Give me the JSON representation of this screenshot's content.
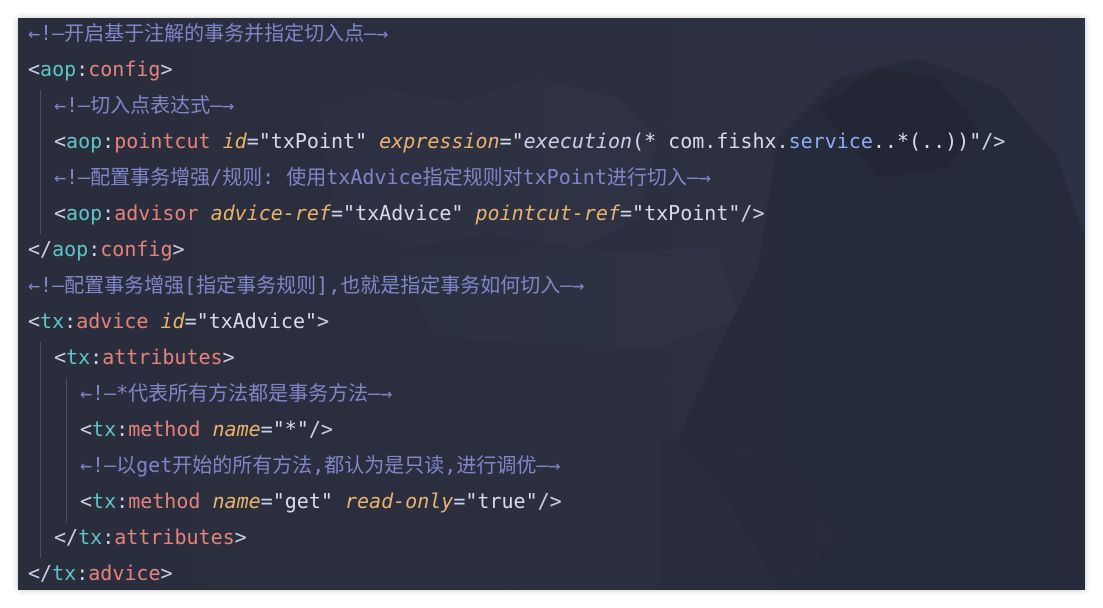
{
  "lines": [
    {
      "indent": 0,
      "comment": "←!—开启基于注解的事务并指定切入点—→"
    },
    {
      "indent": 0,
      "open": "<",
      "ns": "aop",
      "colon": ":",
      "tag": "config",
      "close": ">"
    },
    {
      "indent": 1,
      "comment": "←!—切入点表达式—→"
    },
    {
      "indent": 1,
      "open": "<",
      "ns": "aop",
      "colon": ":",
      "tag": "pointcut",
      "a1": "id",
      "v1": "\"txPoint\"",
      "a2": "expression",
      "v2pre": "=\"",
      "v2kw": "execution",
      "v2mid": "(* com.fishx.",
      "v2pkg": "service",
      "v2post": "..*(..))\"",
      "close": "/>"
    },
    {
      "indent": 1,
      "comment": "←!—配置事务增强/规则: 使用txAdvice指定规则对txPoint进行切入—→"
    },
    {
      "indent": 1,
      "open": "<",
      "ns": "aop",
      "colon": ":",
      "tag": "advisor",
      "a1": "advice-ref",
      "v1": "\"txAdvice\"",
      "a2": "pointcut-ref",
      "v2": "\"txPoint\"",
      "close": "/>"
    },
    {
      "indent": 0,
      "open": "</",
      "ns": "aop",
      "colon": ":",
      "tag": "config",
      "close": ">"
    },
    {
      "indent": 0,
      "comment": "←!—配置事务增强[指定事务规则],也就是指定事务如何切入—→"
    },
    {
      "indent": 0,
      "open": "<",
      "ns": "tx",
      "colon": ":",
      "tag": "advice",
      "a1": "id",
      "v1": "\"txAdvice\"",
      "close": ">"
    },
    {
      "indent": 1,
      "open": "<",
      "ns": "tx",
      "colon": ":",
      "tag": "attributes",
      "close": ">"
    },
    {
      "indent": 2,
      "comment": "←!—*代表所有方法都是事务方法—→"
    },
    {
      "indent": 2,
      "open": "<",
      "ns": "tx",
      "colon": ":",
      "tag": "method",
      "a1": "name",
      "v1": "\"*\"",
      "close": "/>"
    },
    {
      "indent": 2,
      "comment": "←!—以get开始的所有方法,都认为是只读,进行调优—→"
    },
    {
      "indent": 2,
      "open": "<",
      "ns": "tx",
      "colon": ":",
      "tag": "method",
      "a1": "name",
      "v1": "\"get\"",
      "a2": "read-only",
      "v2": "\"true\"",
      "close": "/>"
    },
    {
      "indent": 1,
      "open": "</",
      "ns": "tx",
      "colon": ":",
      "tag": "attributes",
      "close": ">"
    },
    {
      "indent": 0,
      "open": "</",
      "ns": "tx",
      "colon": ":",
      "tag": "advice",
      "close": ">"
    }
  ],
  "colors": {
    "background": "#292c3b",
    "comment": "#7f86c6",
    "namespace": "#5ec4c7",
    "tag": "#e3837b",
    "attribute": "#e8b36b",
    "string": "#d6dbea"
  }
}
